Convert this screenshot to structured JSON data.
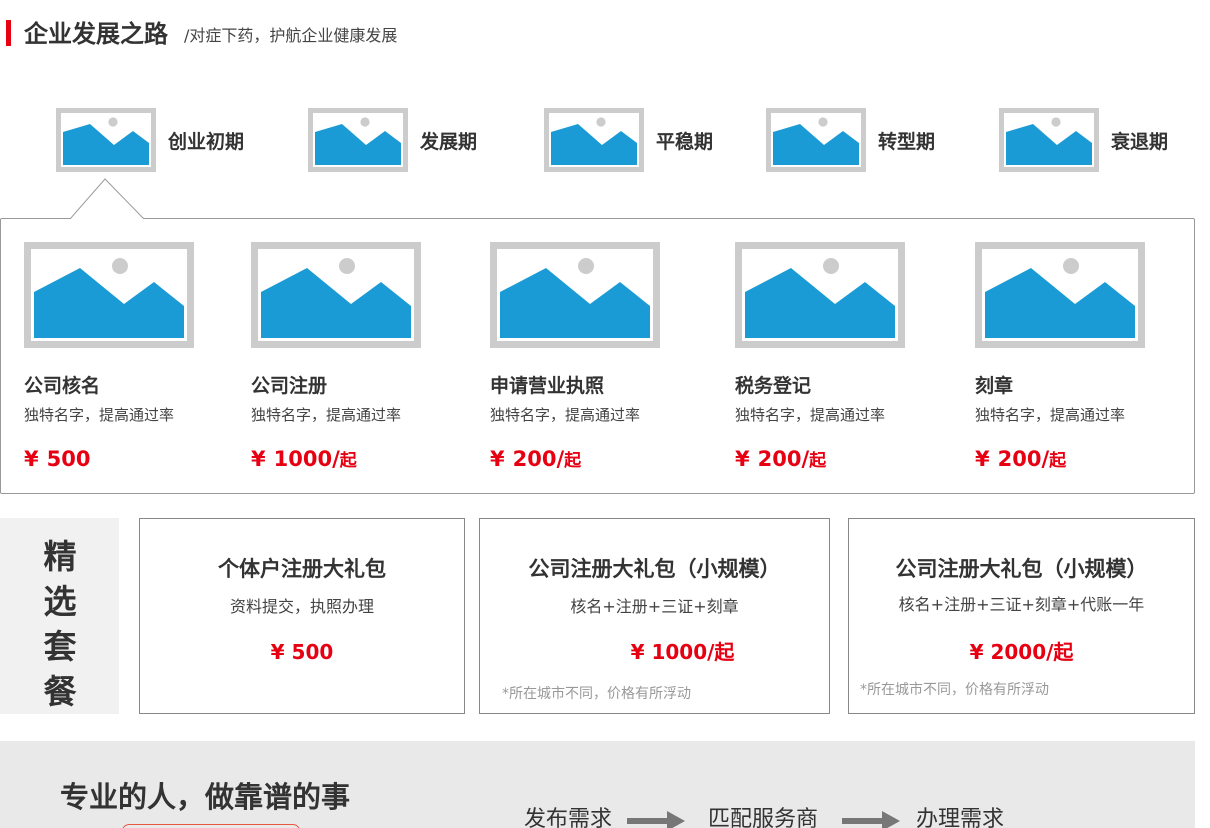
{
  "header": {
    "title": "企业发展之路",
    "subtitle": "/对症下药，护航企业健康发展",
    "accent_color": "#e60012"
  },
  "stages": [
    {
      "label": "创业初期",
      "icon": "image-placeholder-icon",
      "active": true
    },
    {
      "label": "发展期",
      "icon": "image-placeholder-icon",
      "active": false
    },
    {
      "label": "平稳期",
      "icon": "image-placeholder-icon",
      "active": false
    },
    {
      "label": "转型期",
      "icon": "image-placeholder-icon",
      "active": false
    },
    {
      "label": "衰退期",
      "icon": "image-placeholder-icon",
      "active": false
    }
  ],
  "services": [
    {
      "name": "公司核名",
      "desc": "独特名字，提高通过率",
      "currency": "¥",
      "price": "500",
      "suffix": ""
    },
    {
      "name": "公司注册",
      "desc": "独特名字，提高通过率",
      "currency": "¥",
      "price": "1000/",
      "suffix": "起"
    },
    {
      "name": "申请营业执照",
      "desc": "独特名字，提高通过率",
      "currency": "¥",
      "price": "200/",
      "suffix": "起"
    },
    {
      "name": "税务登记",
      "desc": "独特名字，提高通过率",
      "currency": "¥",
      "price": "200/",
      "suffix": "起"
    },
    {
      "name": "刻章",
      "desc": "独特名字，提高通过率",
      "currency": "¥",
      "price": "200/",
      "suffix": "起"
    }
  ],
  "packages": {
    "heading": [
      "精",
      "选",
      "套",
      "餐"
    ],
    "items": [
      {
        "name": "个体户注册大礼包",
        "desc": "资料提交，执照办理",
        "price": "¥ 500",
        "note": ""
      },
      {
        "name": "公司注册大礼包（小规模）",
        "desc": "核名+注册+三证+刻章",
        "price": "¥ 1000/起",
        "note": "*所在城市不同，价格有所浮动"
      },
      {
        "name": "公司注册大礼包（小规模）",
        "desc": "核名+注册+三证+刻章+代账一年",
        "price": "¥ 2000/起",
        "note": "*所在城市不同，价格有所浮动"
      }
    ]
  },
  "process": {
    "title": "专业的人，做靠谱的事",
    "steps": [
      "发布需求",
      "匹配服务商",
      "办理需求"
    ]
  },
  "colors": {
    "placeholder_blue": "#1b9bd6",
    "placeholder_frame": "#cccccc",
    "price_red": "#e60012"
  }
}
